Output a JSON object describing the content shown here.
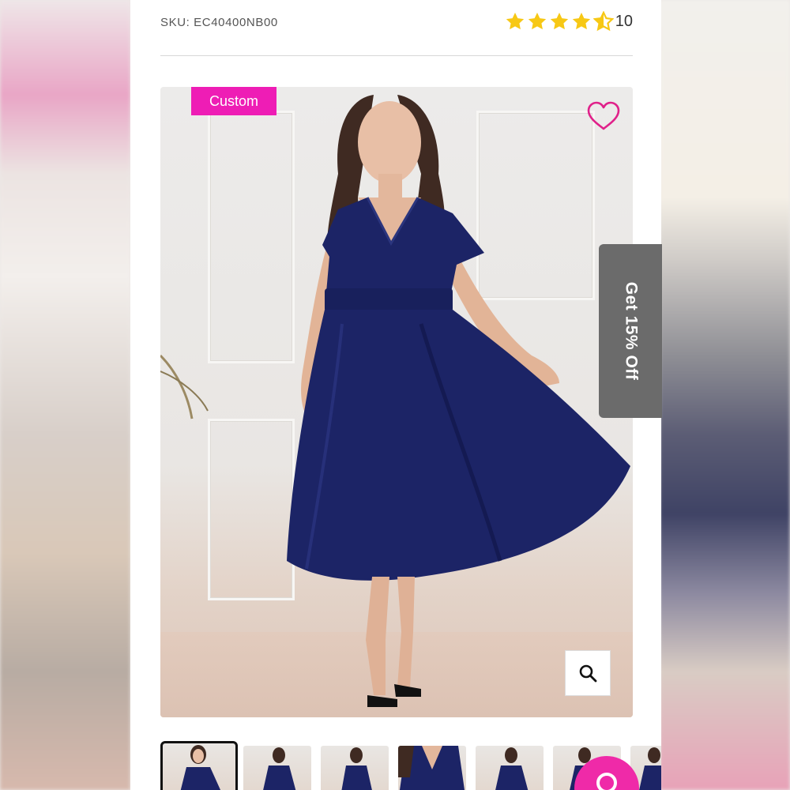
{
  "product": {
    "sku": "SKU: EC40400NB00",
    "rating": 4.5,
    "review_count": "10",
    "badge": "Custom"
  },
  "promo": {
    "label": "Get 15% Off"
  },
  "colors": {
    "accent": "#ee1db5",
    "star": "#f7c815",
    "dress": "#1c2466",
    "promo_bg": "#6b6b6b"
  },
  "icons": {
    "wishlist": "heart-icon",
    "zoom": "search-icon",
    "fab": "search-icon"
  },
  "gallery": {
    "thumbnail_count": 7,
    "active_index": 0
  }
}
